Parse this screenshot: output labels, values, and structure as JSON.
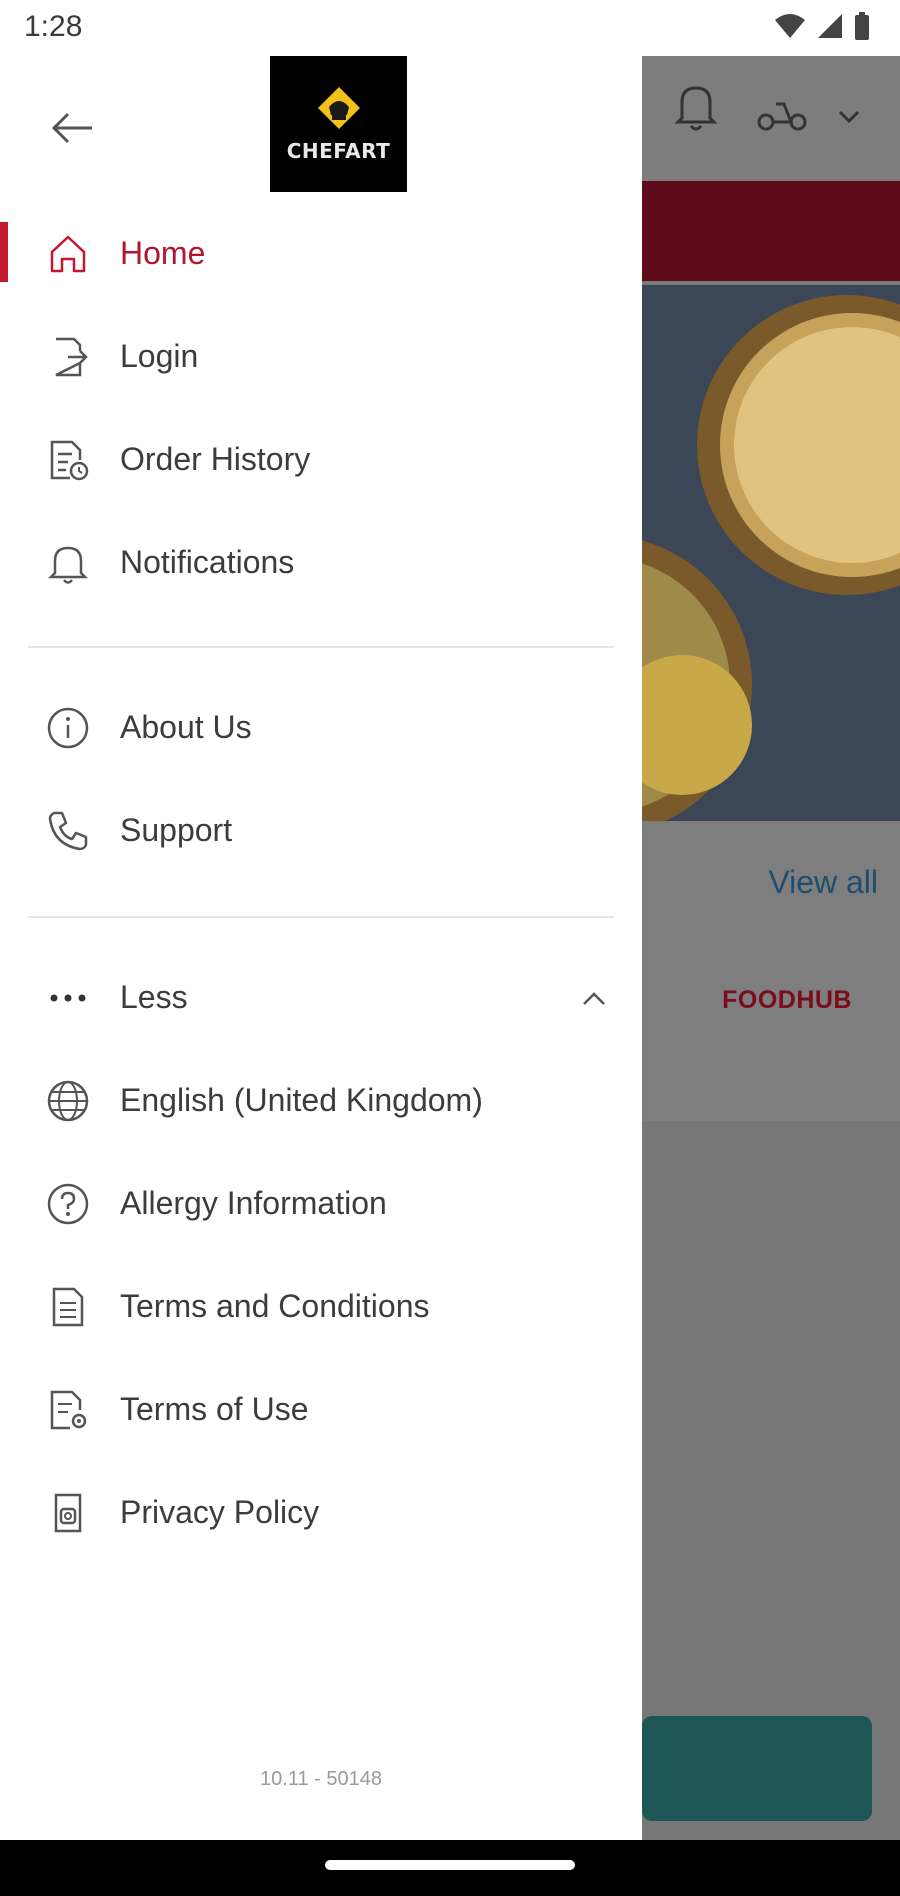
{
  "status_bar": {
    "time": "1:28"
  },
  "drawer": {
    "logo_text": "CHEFART",
    "main_items": [
      {
        "label": "Home",
        "icon": "home-icon",
        "active": true
      },
      {
        "label": "Login",
        "icon": "login-icon"
      },
      {
        "label": "Order History",
        "icon": "order-history-icon"
      },
      {
        "label": "Notifications",
        "icon": "bell-icon"
      }
    ],
    "info_items": [
      {
        "label": "About Us",
        "icon": "info-icon"
      },
      {
        "label": "Support",
        "icon": "phone-icon"
      }
    ],
    "more": {
      "label": "Less",
      "icon": "more-dots-icon"
    },
    "extra_items": [
      {
        "label": "English (United Kingdom)",
        "icon": "globe-icon"
      },
      {
        "label": "Allergy Information",
        "icon": "help-circle-icon"
      },
      {
        "label": "Terms and Conditions",
        "icon": "document-icon"
      },
      {
        "label": "Terms of Use",
        "icon": "document-settings-icon"
      },
      {
        "label": "Privacy Policy",
        "icon": "privacy-icon"
      }
    ],
    "version": "10.11 - 50148"
  },
  "background": {
    "view_all": "View all",
    "brand": "FOODHUB"
  },
  "colors": {
    "accent": "#c41730",
    "banner": "#5d0b1b",
    "cta": "#1e5656"
  }
}
